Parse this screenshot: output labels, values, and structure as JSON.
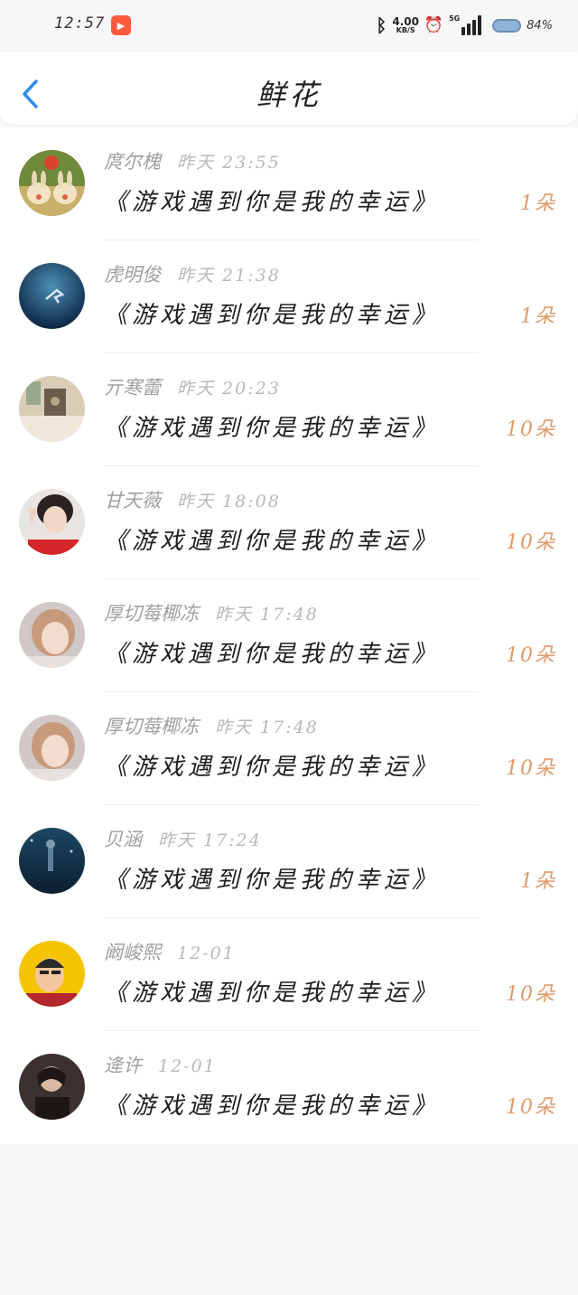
{
  "status_bar": {
    "time": "12:57",
    "net_speed_value": "4.00",
    "net_speed_unit": "KB/S",
    "network_type": "5G",
    "battery": "84%",
    "icons": [
      "app-icon",
      "bluetooth-icon",
      "alarm-icon",
      "signal-icon",
      "battery-icon"
    ]
  },
  "header": {
    "title": "鲜花",
    "back_icon": "chevron-left-icon",
    "accent_color": "#2d8cf0"
  },
  "colors": {
    "count": "#e09a6a",
    "meta": "#a0a0a0"
  },
  "items": [
    {
      "name": "庹尔槐",
      "time": "昨天 23:55",
      "content": "《游戏遇到你是我的幸运》",
      "count": "1朵"
    },
    {
      "name": "虎明俊",
      "time": "昨天 21:38",
      "content": "《游戏遇到你是我的幸运》",
      "count": "1朵"
    },
    {
      "name": "亓寒蕾",
      "time": "昨天 20:23",
      "content": "《游戏遇到你是我的幸运》",
      "count": "10朵"
    },
    {
      "name": "甘天薇",
      "time": "昨天 18:08",
      "content": "《游戏遇到你是我的幸运》",
      "count": "10朵"
    },
    {
      "name": "厚切莓椰冻",
      "time": "昨天 17:48",
      "content": "《游戏遇到你是我的幸运》",
      "count": "10朵"
    },
    {
      "name": "厚切莓椰冻",
      "time": "昨天 17:48",
      "content": "《游戏遇到你是我的幸运》",
      "count": "10朵"
    },
    {
      "name": "贝涵",
      "time": "昨天 17:24",
      "content": "《游戏遇到你是我的幸运》",
      "count": "1朵"
    },
    {
      "name": "阚峻熙",
      "time": "12-01",
      "content": "《游戏遇到你是我的幸运》",
      "count": "10朵"
    },
    {
      "name": "逄许",
      "time": "12-01",
      "content": "《游戏遇到你是我的幸运》",
      "count": "10朵"
    }
  ]
}
